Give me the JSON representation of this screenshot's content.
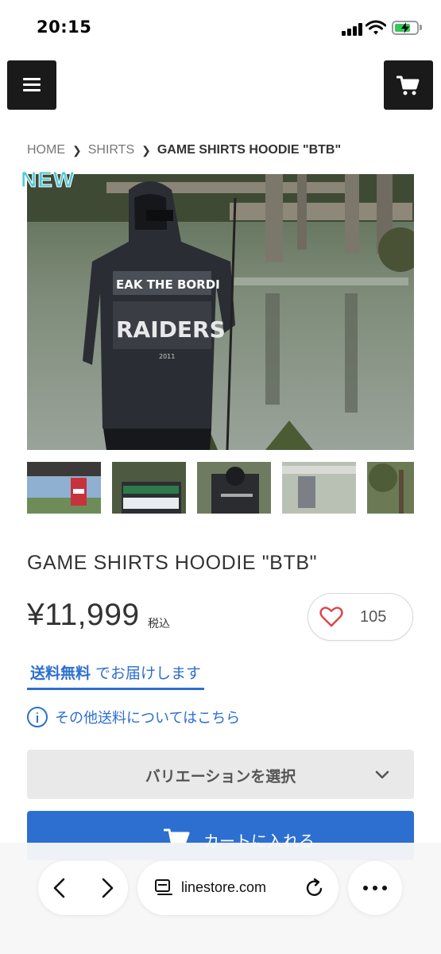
{
  "status_bar": {
    "time": "20:15"
  },
  "header": {
    "menu_icon": "hamburger-menu-icon",
    "cart_icon": "shopping-cart-icon"
  },
  "breadcrumb": {
    "items": [
      "HOME",
      "SHIRTS",
      "GAME SHIRTS HOODIE \"BTB\""
    ]
  },
  "product": {
    "badge": "NEW",
    "title": "GAME SHIRTS HOODIE \"BTB\"",
    "price": "¥11,999",
    "tax_label": "税込",
    "favorite_count": "105",
    "favorite_icon": "heart-icon"
  },
  "shipping": {
    "free_label_bold": "送料無料",
    "free_label_rest": " でお届けします",
    "other_link": "その他送料についてはこちら"
  },
  "variation": {
    "label": "バリエーションを選択"
  },
  "cart_button": {
    "label": "カートに入れる"
  },
  "browser": {
    "url": "linestore.com"
  },
  "colors": {
    "accent": "#2c6fd0",
    "badge": "#4ec9d8",
    "dark_button": "#1a1a1a",
    "heart": "#e0434b"
  }
}
